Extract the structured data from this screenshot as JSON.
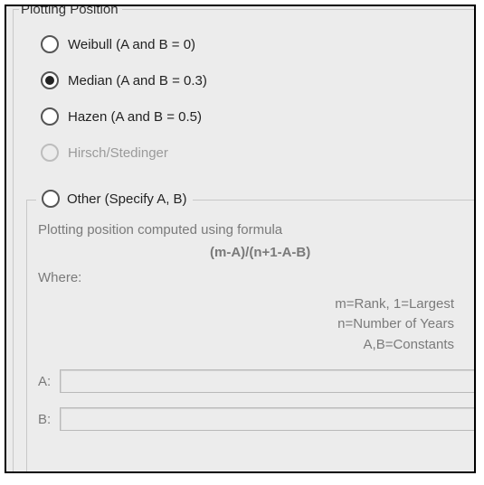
{
  "fieldset": {
    "legend": "Plotting Position",
    "options": {
      "weibull": {
        "label": "Weibull (A and B = 0)",
        "selected": false,
        "enabled": true
      },
      "median": {
        "label": "Median (A and B = 0.3)",
        "selected": true,
        "enabled": true
      },
      "hazen": {
        "label": "Hazen (A and B = 0.5)",
        "selected": false,
        "enabled": true
      },
      "hirsch": {
        "label": "Hirsch/Stedinger",
        "selected": false,
        "enabled": false
      },
      "other": {
        "label": "Other (Specify A, B)",
        "selected": false,
        "enabled": true
      }
    },
    "other_group": {
      "description": "Plotting position computed using formula",
      "formula": "(m-A)/(n+1-A-B)",
      "where_label": "Where:",
      "var_m": "m=Rank, 1=Largest",
      "var_n": "n=Number of Years",
      "var_ab": "A,B=Constants",
      "a_label": "A:",
      "b_label": "B:",
      "a_value": "",
      "b_value": ""
    }
  }
}
